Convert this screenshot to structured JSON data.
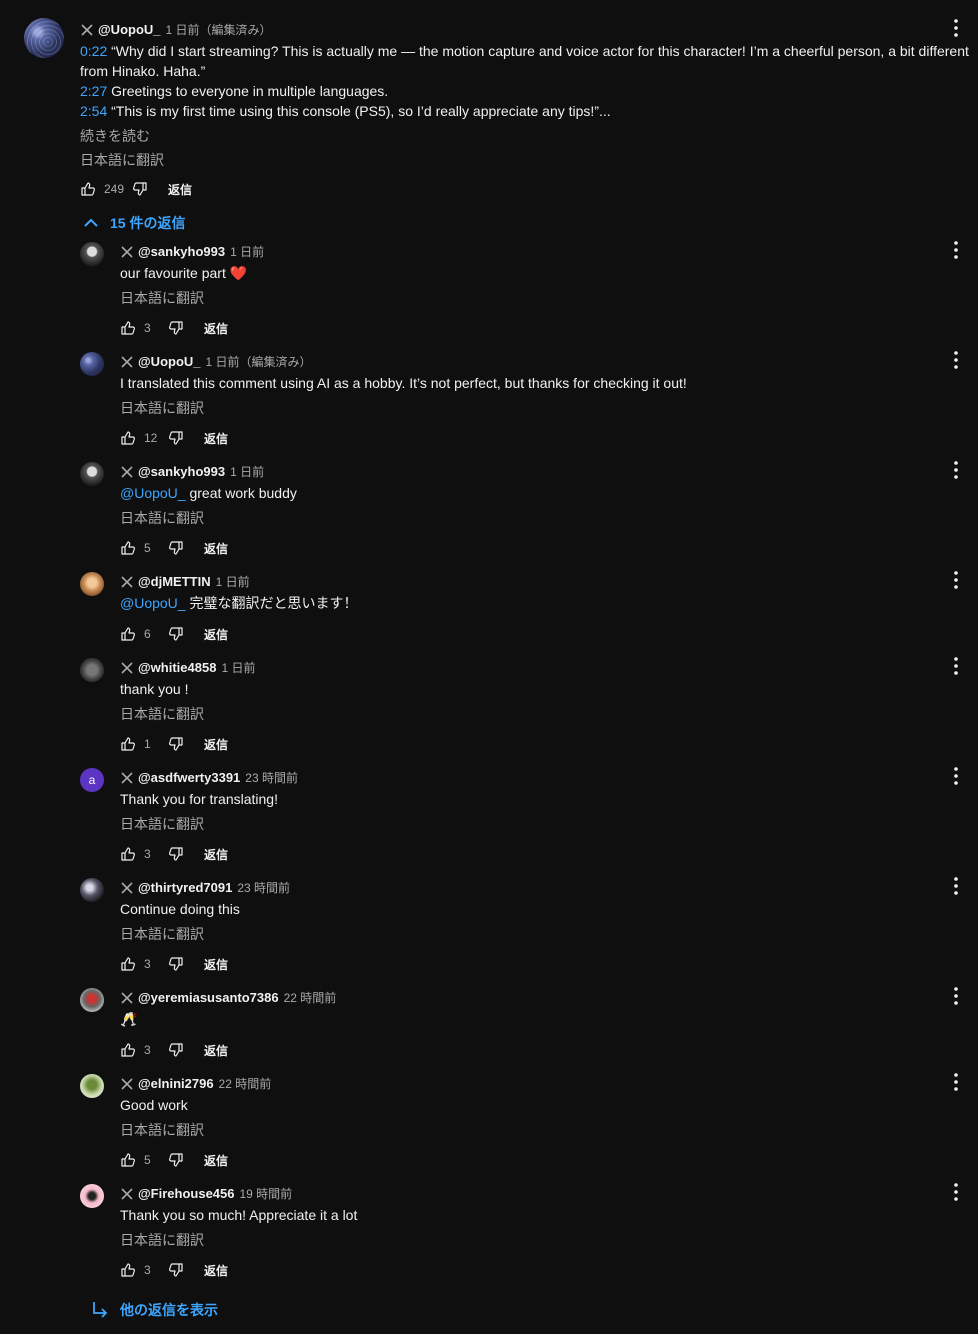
{
  "main_comment": {
    "author": "@UopoU_",
    "time": "1 日前（編集済み）",
    "lines": [
      {
        "ts": "0:22",
        "text": " “Why did I start streaming? This is actually me — the motion capture and voice actor for this character! I’m a cheerful person, a bit different"
      },
      {
        "ts": "",
        "text": "from Hinako. Haha.”"
      },
      {
        "ts": "2:27",
        "text": " Greetings to everyone in multiple languages."
      },
      {
        "ts": "2:54",
        "text": " “This is my first time using this console (PS5), so I’d really appreciate any tips!”..."
      }
    ],
    "read_more": "続きを読む",
    "translate": "日本語に翻訳",
    "likes": "249",
    "reply_label": "返信"
  },
  "replies_toggle": "15 件の返信",
  "replies": [
    {
      "author": "@sankyho993",
      "time": "1 日前",
      "mention": "",
      "text": "our favourite part ❤️",
      "translate": "日本語に翻訳",
      "likes": "3",
      "reply_label": "返信"
    },
    {
      "author": "@UopoU_",
      "time": "1 日前（編集済み）",
      "mention": "",
      "text": "I translated this comment using AI as a hobby. It’s not perfect, but thanks for checking it out!",
      "translate": "日本語に翻訳",
      "likes": "12",
      "reply_label": "返信"
    },
    {
      "author": "@sankyho993",
      "time": "1 日前",
      "mention": " @UopoU_",
      "text": " great work buddy",
      "translate": "日本語に翻訳",
      "likes": "5",
      "reply_label": "返信"
    },
    {
      "author": "@djMETTIN",
      "time": "1 日前",
      "mention": " @UopoU_",
      "text": " 完璧な翻訳だと思います！",
      "translate": "",
      "likes": "6",
      "reply_label": "返信"
    },
    {
      "author": "@whitie4858",
      "time": "1 日前",
      "mention": "",
      "text": "thank you !",
      "translate": "日本語に翻訳",
      "likes": "1",
      "reply_label": "返信"
    },
    {
      "author": "@asdfwerty3391",
      "time": "23 時間前",
      "mention": "",
      "text": "Thank you for translating!",
      "translate": "日本語に翻訳",
      "likes": "3",
      "reply_label": "返信"
    },
    {
      "author": "@thirtyred7091",
      "time": "23 時間前",
      "mention": "",
      "text": "Continue doing this",
      "translate": "日本語に翻訳",
      "likes": "3",
      "reply_label": "返信"
    },
    {
      "author": "@yeremiasusanto7386",
      "time": "22 時間前",
      "mention": "",
      "text": "🥂",
      "translate": "",
      "likes": "3",
      "reply_label": "返信"
    },
    {
      "author": "@elnini2796",
      "time": "22 時間前",
      "mention": "",
      "text": "Good work",
      "translate": "日本語に翻訳",
      "likes": "5",
      "reply_label": "返信"
    },
    {
      "author": "@Firehouse456",
      "time": "19 時間前",
      "mention": "",
      "text": "Thank you so much! Appreciate it a lot",
      "translate": "日本語に翻訳",
      "likes": "3",
      "reply_label": "返信"
    }
  ],
  "show_more_replies": "他の返信を表示",
  "avatar_letter": "a"
}
